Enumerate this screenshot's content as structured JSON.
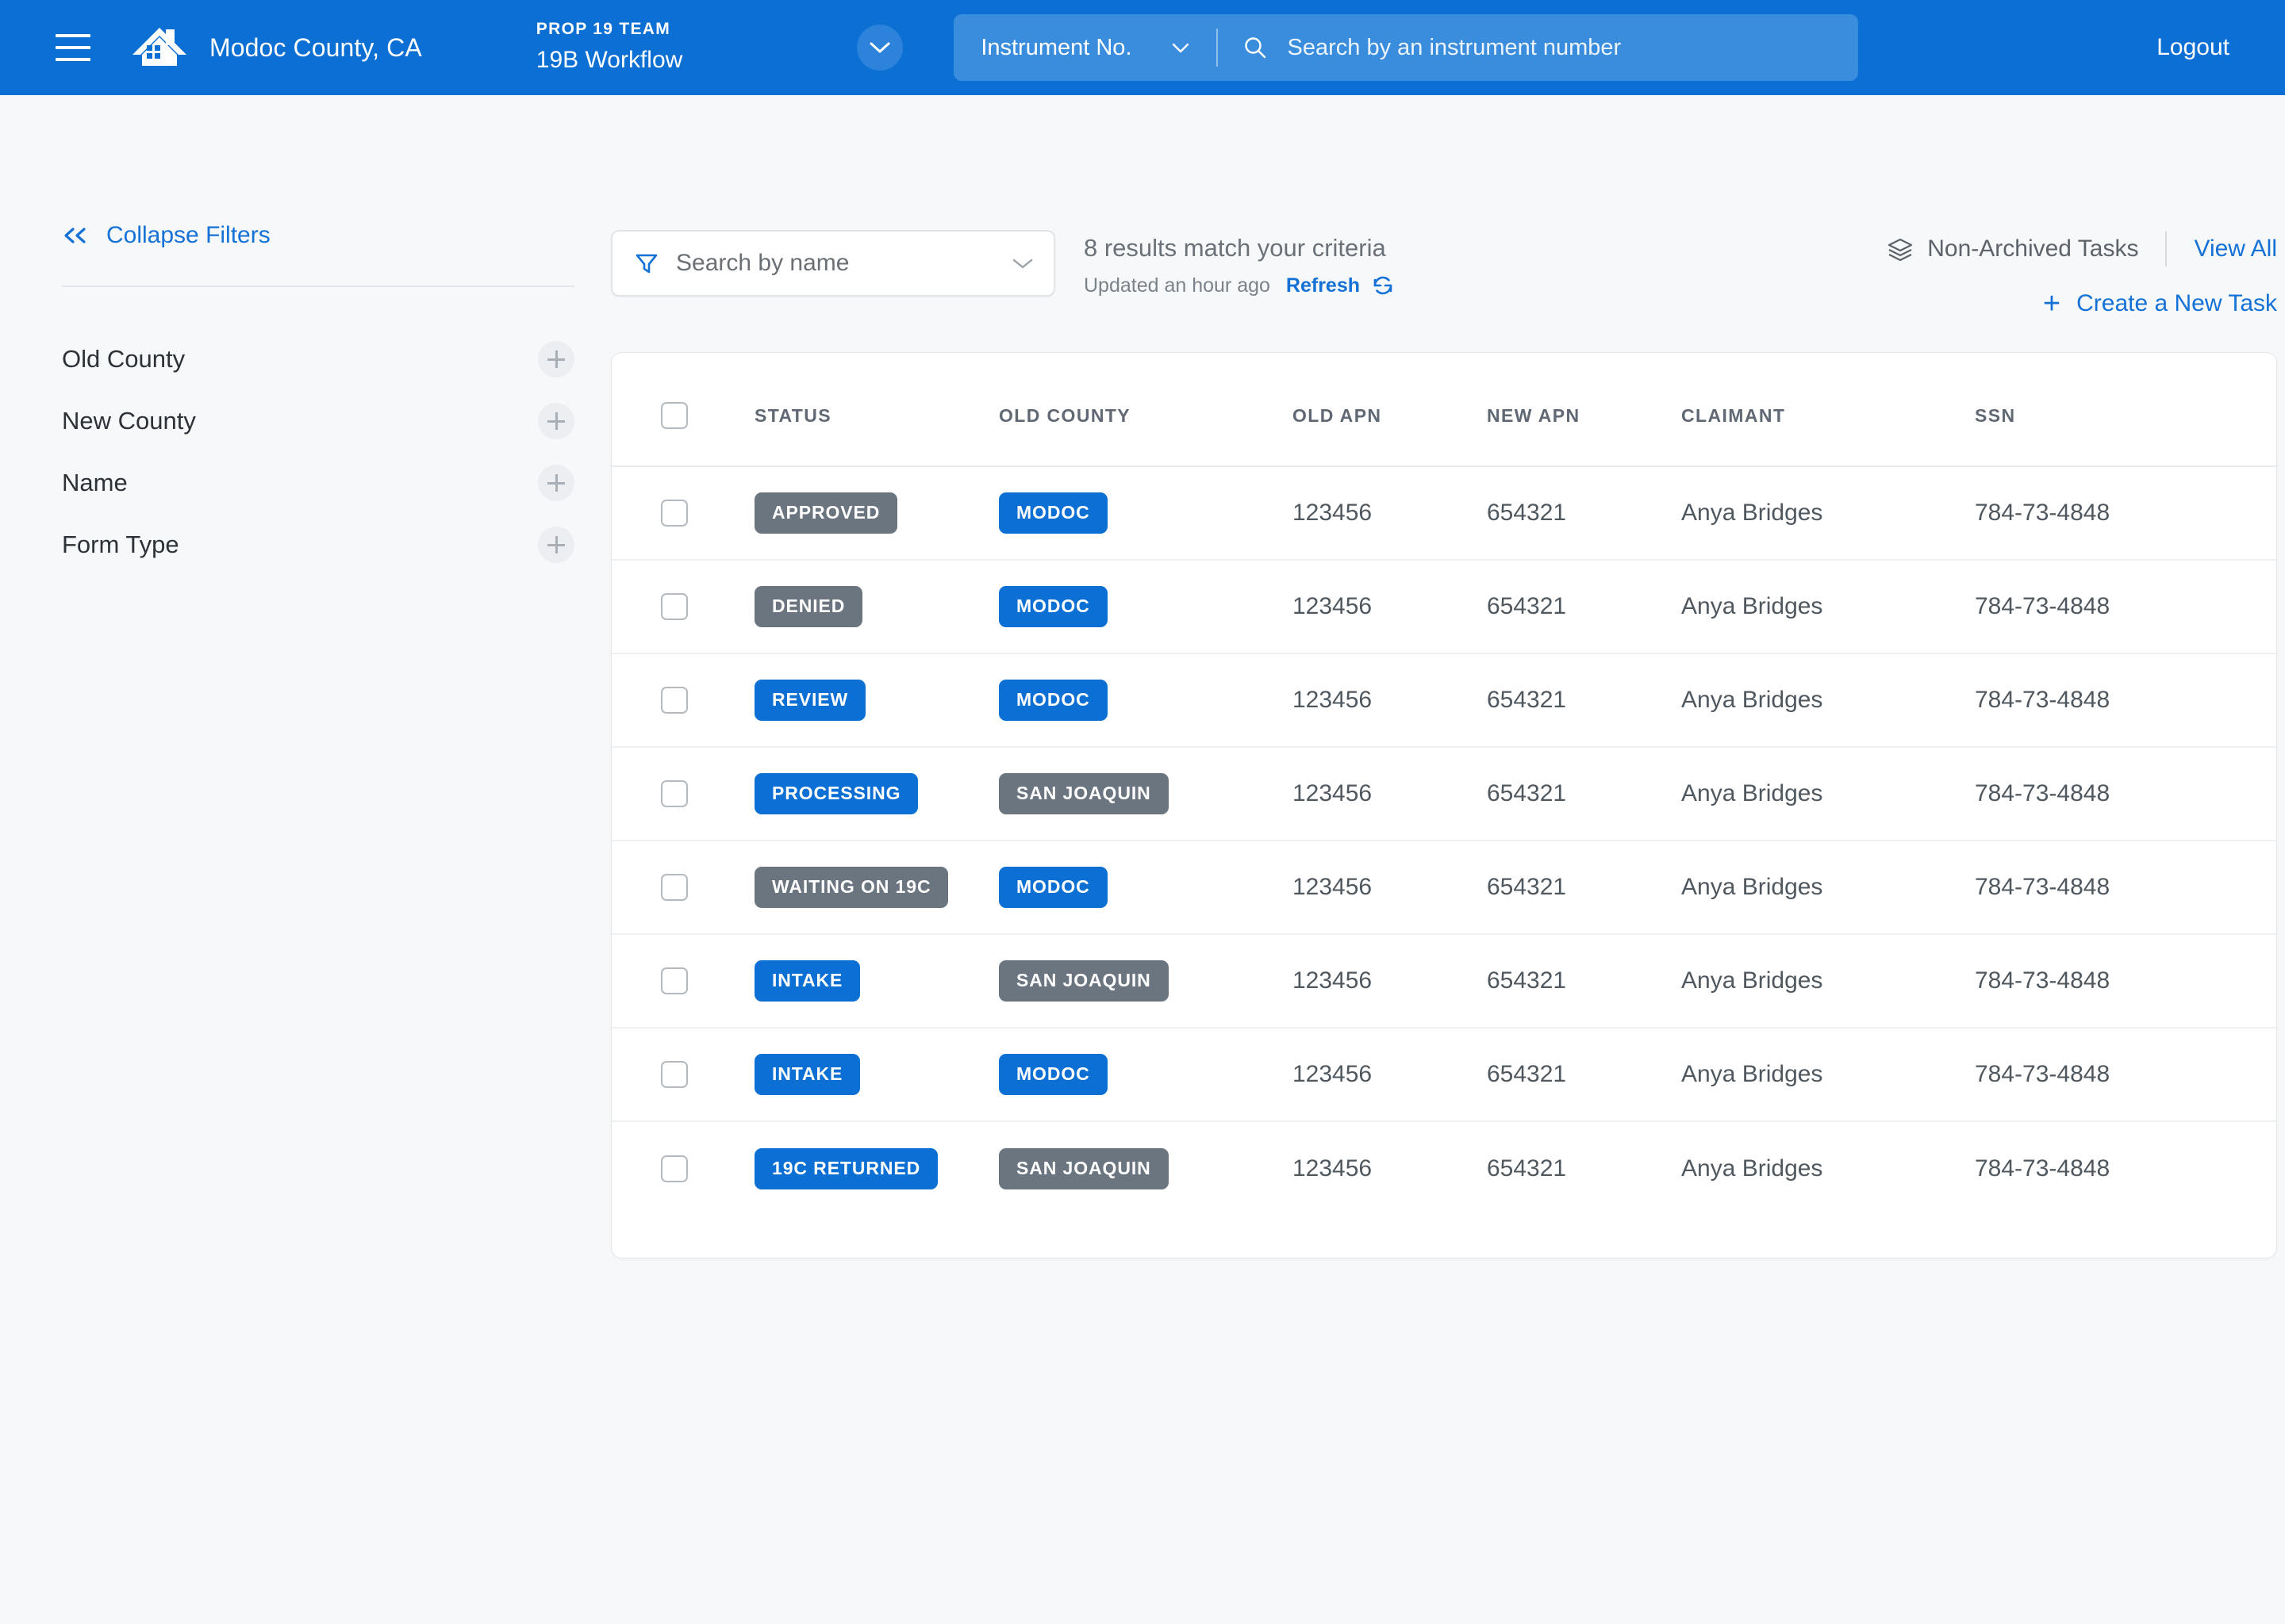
{
  "header": {
    "menu_icon": "hamburger-icon",
    "logo_icon": "house-roof-logo-icon",
    "county": "Modoc County, CA",
    "team_eyebrow": "PROP 19 TEAM",
    "team_title": "19B Workflow",
    "team_chevron_icon": "chevron-down-icon",
    "instrument_select_label": "Instrument No.",
    "instrument_select_chevron_icon": "chevron-down-icon",
    "search_icon": "search-icon",
    "search_placeholder": "Search by an instrument number",
    "search_value": "",
    "logout_label": "Logout",
    "brand_color": "#0b6fd4",
    "search_field_color": "#3a8ddc"
  },
  "sidebar": {
    "collapse_icon": "double-chevron-left-icon",
    "collapse_label": "Collapse Filters",
    "filters": [
      {
        "label": "Old County",
        "add_icon": "plus-icon"
      },
      {
        "label": "New County",
        "add_icon": "plus-icon"
      },
      {
        "label": "Name",
        "add_icon": "plus-icon"
      },
      {
        "label": "Form Type",
        "add_icon": "plus-icon"
      }
    ]
  },
  "toolbar": {
    "filter_icon": "funnel-filter-icon",
    "name_search_placeholder": "Search by name",
    "name_search_value": "",
    "name_search_chevron_icon": "chevron-down-icon",
    "results_text": "8 results match your criteria",
    "updated_text": "Updated an hour ago",
    "refresh_label": "Refresh",
    "refresh_icon": "refresh-icon",
    "archived_icon": "layers-stack-icon",
    "archived_label": "Non-Archived Tasks",
    "view_all_label": "View All",
    "create_task_plus_icon": "plus-icon",
    "create_task_label": "Create a New Task",
    "link_color": "#1471d6"
  },
  "table": {
    "select_all_checkbox": "unchecked",
    "columns": [
      "STATUS",
      "OLD COUNTY",
      "OLD APN",
      "NEW APN",
      "CLAIMANT",
      "SSN"
    ],
    "badge_colors": {
      "blue": "#0b6fd4",
      "gray": "#6b7580"
    },
    "rows": [
      {
        "checked": false,
        "status": "APPROVED",
        "status_color": "gray",
        "old_county": "MODOC",
        "county_color": "blue",
        "old_apn": "123456",
        "new_apn": "654321",
        "claimant": "Anya Bridges",
        "ssn": "784-73-4848"
      },
      {
        "checked": false,
        "status": "DENIED",
        "status_color": "gray",
        "old_county": "MODOC",
        "county_color": "blue",
        "old_apn": "123456",
        "new_apn": "654321",
        "claimant": "Anya Bridges",
        "ssn": "784-73-4848"
      },
      {
        "checked": false,
        "status": "REVIEW",
        "status_color": "blue",
        "old_county": "MODOC",
        "county_color": "blue",
        "old_apn": "123456",
        "new_apn": "654321",
        "claimant": "Anya Bridges",
        "ssn": "784-73-4848"
      },
      {
        "checked": false,
        "status": "PROCESSING",
        "status_color": "blue",
        "old_county": "SAN JOAQUIN",
        "county_color": "gray",
        "old_apn": "123456",
        "new_apn": "654321",
        "claimant": "Anya Bridges",
        "ssn": "784-73-4848"
      },
      {
        "checked": false,
        "status": "WAITING ON 19C",
        "status_color": "gray",
        "old_county": "MODOC",
        "county_color": "blue",
        "old_apn": "123456",
        "new_apn": "654321",
        "claimant": "Anya Bridges",
        "ssn": "784-73-4848"
      },
      {
        "checked": false,
        "status": "INTAKE",
        "status_color": "blue",
        "old_county": "SAN JOAQUIN",
        "county_color": "gray",
        "old_apn": "123456",
        "new_apn": "654321",
        "claimant": "Anya Bridges",
        "ssn": "784-73-4848"
      },
      {
        "checked": false,
        "status": "INTAKE",
        "status_color": "blue",
        "old_county": "MODOC",
        "county_color": "blue",
        "old_apn": "123456",
        "new_apn": "654321",
        "claimant": "Anya Bridges",
        "ssn": "784-73-4848"
      },
      {
        "checked": false,
        "status": "19C RETURNED",
        "status_color": "blue",
        "old_county": "SAN JOAQUIN",
        "county_color": "gray",
        "old_apn": "123456",
        "new_apn": "654321",
        "claimant": "Anya Bridges",
        "ssn": "784-73-4848"
      }
    ]
  }
}
